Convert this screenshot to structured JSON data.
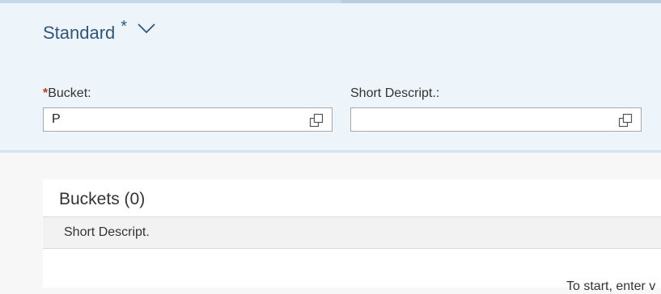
{
  "filter_bar": {
    "variant_name": "Standard",
    "variant_modified_marker": "*",
    "variant_dropdown_icon": "chevron-down-icon",
    "fields": [
      {
        "label": "Bucket:",
        "required_marker": "*",
        "value": "P",
        "icon": "value-help-icon"
      },
      {
        "label": "Short Descript.:",
        "value": "",
        "icon": "value-help-icon"
      }
    ]
  },
  "table": {
    "title": "Buckets (0)",
    "columns": [
      "Short Descript."
    ],
    "empty_text": "To start, enter v"
  },
  "colors": {
    "header_bg": "#edf4fa",
    "variant_text": "#32577a",
    "required": "#c0392b"
  }
}
